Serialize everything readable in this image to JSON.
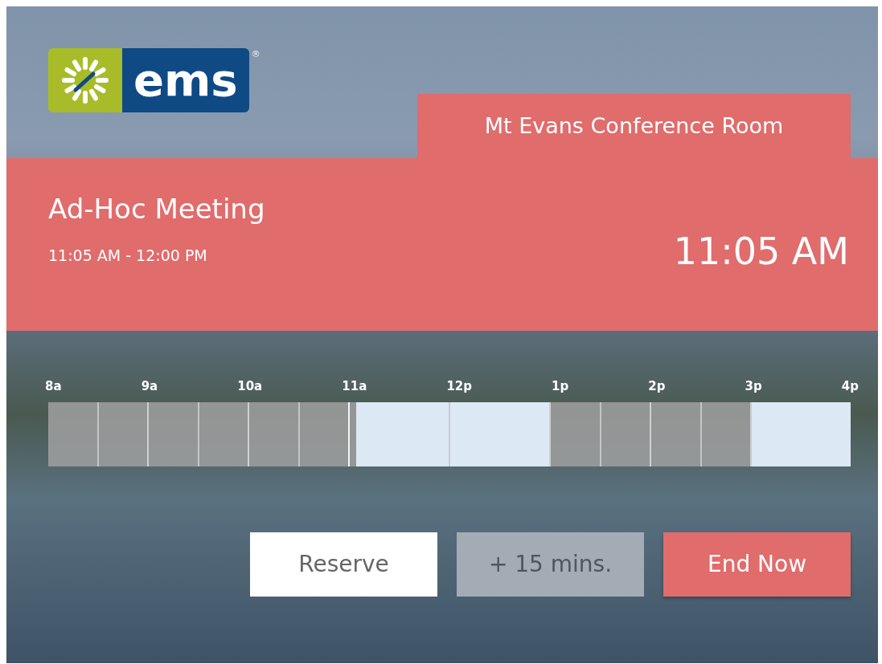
{
  "logo": {
    "wordmark": "ems",
    "mark": "®"
  },
  "room": {
    "name": "Mt Evans Conference Room"
  },
  "meeting": {
    "title": "Ad-Hoc Meeting",
    "time_range": "11:05 AM - 12:00 PM",
    "clock": "11:05 AM"
  },
  "timeline": {
    "hours": [
      "8a",
      "9a",
      "10a",
      "11a",
      "12p",
      "1p",
      "2p",
      "3p",
      "4p"
    ],
    "slots": [
      {
        "kind": "busy"
      },
      {
        "kind": "busy"
      },
      {
        "kind": "busy"
      },
      {
        "kind": "ending"
      },
      {
        "kind": "free"
      },
      {
        "kind": "busy"
      },
      {
        "kind": "busy"
      },
      {
        "kind": "free"
      }
    ]
  },
  "buttons": [
    {
      "label": "Reserve",
      "kind": "light",
      "disabled": false
    },
    {
      "label": "+ 15 mins.",
      "kind": "muted",
      "disabled": true
    },
    {
      "label": "End Now",
      "kind": "accent",
      "disabled": false
    }
  ]
}
